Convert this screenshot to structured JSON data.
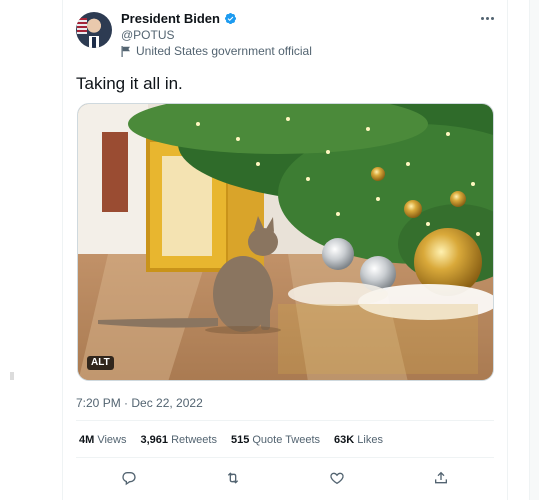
{
  "author": {
    "display_name": "President Biden",
    "handle": "@POTUS",
    "label": "United States government official"
  },
  "icons": {
    "verified": "verified-badge-icon",
    "label_flag": "flag-icon",
    "more": "more-options-icon",
    "reply": "reply-icon",
    "retweet": "retweet-icon",
    "like": "like-icon",
    "share": "share-icon"
  },
  "tweet": {
    "text": "Taking it all in.",
    "media_alt_badge": "ALT",
    "timestamp": "7:20 PM · Dec 22, 2022"
  },
  "stats": {
    "views": {
      "value": "4M",
      "label": "Views"
    },
    "retweets": {
      "value": "3,961",
      "label": "Retweets"
    },
    "quote_tweets": {
      "value": "515",
      "label": "Quote Tweets"
    },
    "likes": {
      "value": "63K",
      "label": "Likes"
    }
  },
  "colors": {
    "verified_blue": "#1d9bf0",
    "secondary_text": "#536471",
    "primary_text": "#0f1419",
    "divider": "#eff3f4"
  }
}
